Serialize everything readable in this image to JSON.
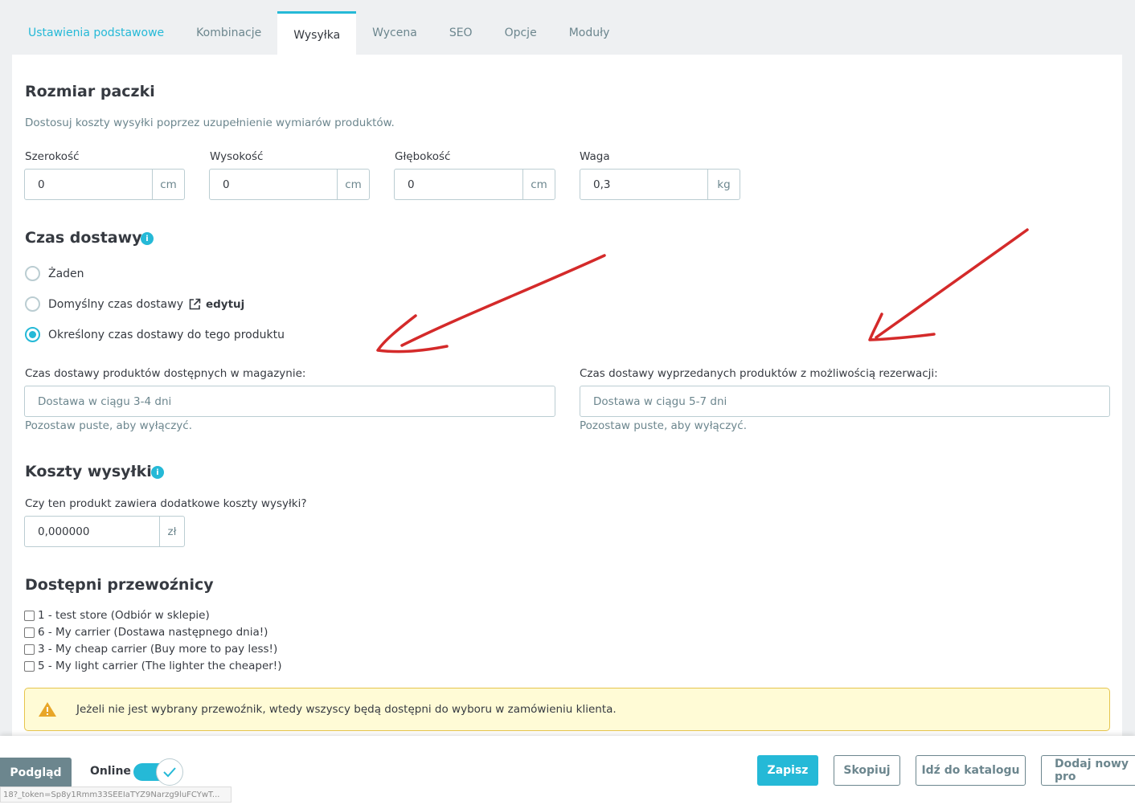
{
  "tabs": [
    "Ustawienia podstawowe",
    "Kombinacje",
    "Wysyłka",
    "Wycena",
    "SEO",
    "Opcje",
    "Moduły"
  ],
  "package": {
    "title": "Rozmiar paczki",
    "description": "Dostosuj koszty wysyłki poprzez uzupełnienie wymiarów produktów.",
    "fields": [
      {
        "label": "Szerokość",
        "value": "0",
        "unit": "cm"
      },
      {
        "label": "Wysokość",
        "value": "0",
        "unit": "cm"
      },
      {
        "label": "Głębokość",
        "value": "0",
        "unit": "cm"
      },
      {
        "label": "Waga",
        "value": "0,3",
        "unit": "kg"
      }
    ]
  },
  "delivery": {
    "title": "Czas dostawy",
    "option_none": "Żaden",
    "option_default": "Domyślny czas dostawy",
    "edit_label": "edytuj",
    "option_specific": "Określony czas dostawy do tego produktu",
    "in_stock_label": "Czas dostawy produktów dostępnych w magazynie:",
    "in_stock_placeholder": "Dostawa w ciągu 3-4 dni",
    "out_stock_label": "Czas dostawy wyprzedanych produktów z możliwością rezerwacji:",
    "out_stock_placeholder": "Dostawa w ciągu 5-7 dni",
    "hint": "Pozostaw puste, aby wyłączyć."
  },
  "shipping_costs": {
    "title": "Koszty wysyłki",
    "question": "Czy ten produkt zawiera dodatkowe koszty wysyłki?",
    "value": "0,000000",
    "unit": "zł"
  },
  "carriers": {
    "title": "Dostępni przewoźnicy",
    "items": [
      "1 - test store (Odbiór w sklepie)",
      "6 - My carrier (Dostawa następnego dnia!)",
      "3 - My cheap carrier (Buy more to pay less!)",
      "5 - My light carrier (The lighter the cheaper!)"
    ],
    "warning": "Jeżeli nie jest wybrany przewoźnik, wtedy wszyscy będą dostępni do wyboru w zamówieniu klienta."
  },
  "footer": {
    "preview": "Podgląd",
    "online": "Online",
    "save": "Zapisz",
    "duplicate": "Skopiuj",
    "catalog": "Idź do katalogu",
    "add_new": "Dodaj nowy pro",
    "url": "18?_token=Sp8y1Rmm33SEEIaTYZ9Narzg9luFCYwT..."
  },
  "colors": {
    "accent": "#25b9d7",
    "annotation_arrow": "#d42a2a",
    "warning_bg": "#fffbd6"
  }
}
